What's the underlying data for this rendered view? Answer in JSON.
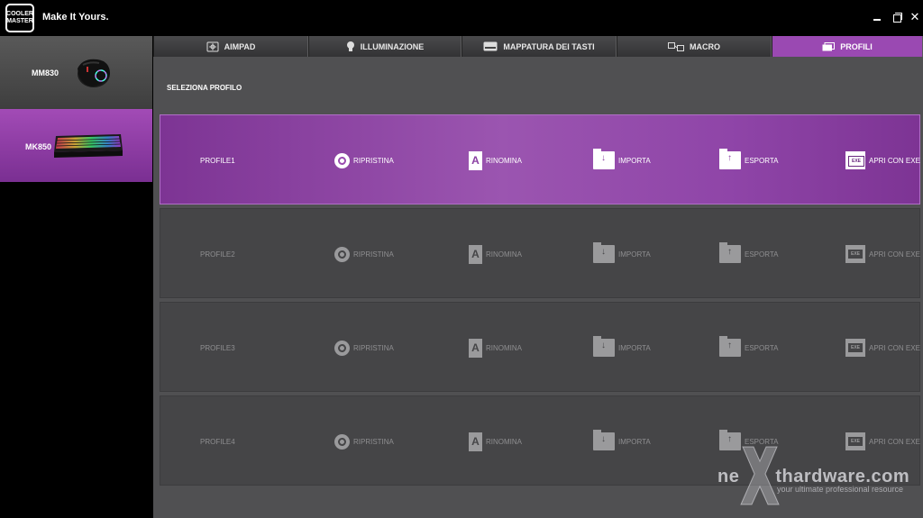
{
  "app": {
    "logo_line1": "COOLER",
    "logo_line2": "MASTER",
    "tagline": "Make It Yours."
  },
  "window_controls": {
    "minimize_icon": "minimize-icon",
    "maximize_icon": "restore-icon",
    "close_label": "✕"
  },
  "devices": [
    {
      "name": "MM830",
      "icon": "mouse-icon",
      "selected": false
    },
    {
      "name": "MK850",
      "icon": "keyboard-icon",
      "selected": true
    }
  ],
  "tabs": [
    {
      "label": "AIMPAD",
      "icon": "aimpad-icon",
      "active": false
    },
    {
      "label": "ILLUMINAZIONE",
      "icon": "bulb-icon",
      "active": false
    },
    {
      "label": "MAPPATURA DEI TASTI",
      "icon": "keyboard-icon",
      "active": false
    },
    {
      "label": "MACRO",
      "icon": "macro-icon",
      "active": false
    },
    {
      "label": "PROFILI",
      "icon": "profile-icon",
      "active": true
    }
  ],
  "section_title": "SELEZIONA PROFILO",
  "actions": {
    "restore": "RIPRISTINA",
    "rename": "RINOMINA",
    "import": "IMPORTA",
    "export": "ESPORTA",
    "open_exe": "APRI CON EXE",
    "exe_icon_text": "EXE",
    "rename_icon_text": "A"
  },
  "profiles": [
    {
      "name": "PROFILE1",
      "active": true
    },
    {
      "name": "PROFILE2",
      "active": false
    },
    {
      "name": "PROFILE3",
      "active": false
    },
    {
      "name": "PROFILE4",
      "active": false
    }
  ],
  "watermark": {
    "brand_pre": "ne",
    "brand_post": "thardware.com",
    "tagline": "your ultimate professional resource"
  },
  "colors": {
    "accent": "#9a49b2",
    "panel": "#505052",
    "card": "#454547"
  }
}
